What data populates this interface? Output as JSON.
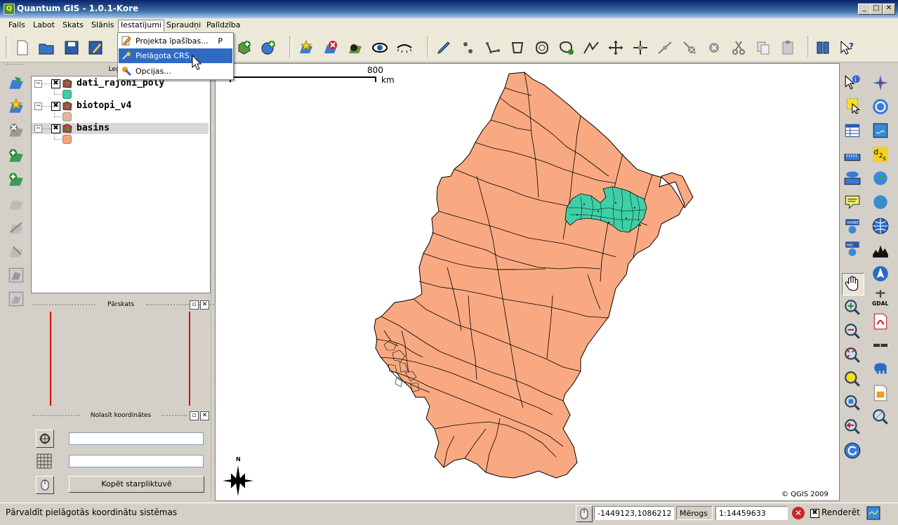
{
  "window": {
    "title": "Quantum GIS - 1.0.1-Kore",
    "app_icon": "Q",
    "min": "_",
    "max": "□",
    "close": "✕"
  },
  "menubar": [
    "Fails",
    "Labot",
    "Skats",
    "Slānis",
    "Iestatījumi",
    "Spraudņi",
    "Palīdzība"
  ],
  "dropdown": {
    "items": [
      {
        "label": "Projekta īpašības...",
        "shortcut": "P",
        "icon": "project-properties-icon"
      },
      {
        "label": "Pielāgota CRS...",
        "shortcut": "",
        "icon": "custom-crs-icon"
      },
      {
        "label": "Opcijas...",
        "shortcut": "",
        "icon": "options-wrench-icon"
      }
    ]
  },
  "legend": {
    "title": "Leģend",
    "layers": [
      {
        "name": "dati_rajoni_poly",
        "checked": "✖",
        "color": "#3fcfa6"
      },
      {
        "name": "biotopi_v4",
        "checked": "✖",
        "color": "#e0b8a0"
      },
      {
        "name": "basins",
        "checked": "✖",
        "color": "#f4a57a"
      }
    ]
  },
  "overview": {
    "title": "Pārskats"
  },
  "coords": {
    "title": "Nolasīt koordinātes",
    "copy_button": "Kopēt starpliktuvē",
    "field1": "",
    "field2": ""
  },
  "map": {
    "scalebar_value": "800",
    "scalebar_unit": "km",
    "north_label": "N",
    "copyright": "© QGIS 2009",
    "basin_color": "#f9a981",
    "district_color": "#3fcfa6"
  },
  "statusbar": {
    "message": "Pārvaldīt pielāgotās koordinātu sistēmas",
    "coordinates": "-1449123,1086212",
    "scale_label": "Mērogs",
    "scale_value": "1:14459633",
    "render_label": "Renderēt",
    "render_checked": "✖"
  }
}
